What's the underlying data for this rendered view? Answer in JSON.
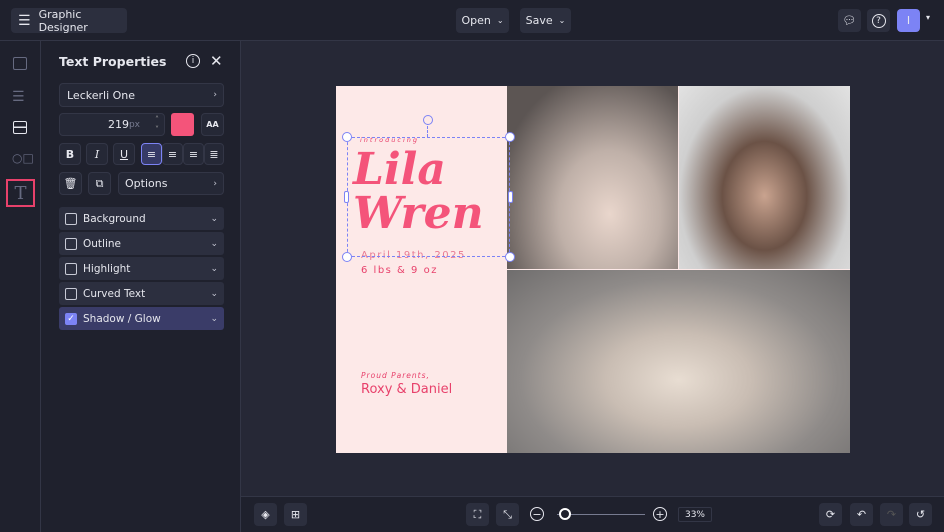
{
  "header": {
    "app_title": "Graphic Designer",
    "open_label": "Open",
    "save_label": "Save",
    "avatar_initial": "I"
  },
  "panel": {
    "title": "Text Properties",
    "font": "Leckerli One",
    "font_size": "219",
    "font_unit": "px",
    "text_color": "#f4547a",
    "options_label": "Options",
    "accordions": [
      {
        "label": "Background",
        "checked": false
      },
      {
        "label": "Outline",
        "checked": false
      },
      {
        "label": "Highlight",
        "checked": false
      },
      {
        "label": "Curved Text",
        "checked": false
      },
      {
        "label": "Shadow / Glow",
        "checked": true
      }
    ]
  },
  "card": {
    "introducing": "introducing",
    "name_line1": "Lila",
    "name_line2": "Wren",
    "date": "April 19th, 2025",
    "weight": "6 lbs & 9 oz",
    "parents_label": "Proud Parents,",
    "parents": "Roxy & Daniel"
  },
  "zoom": {
    "value": "33%",
    "level": 0.05
  },
  "colors": {
    "accent": "#7c83f5",
    "pink": "#f4547a",
    "highlight": "#e8416b"
  }
}
